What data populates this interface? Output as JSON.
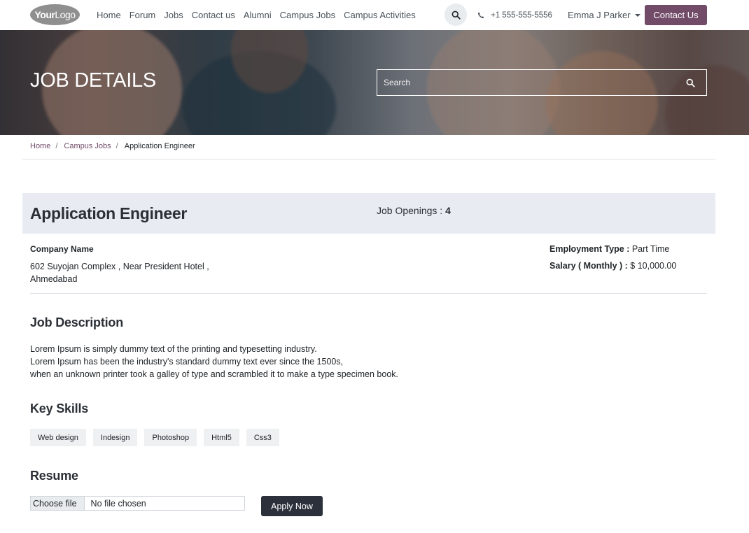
{
  "brand": {
    "logo_bold": "Your",
    "logo_light": "Logo"
  },
  "nav": {
    "links": [
      "Home",
      "Forum",
      "Jobs",
      "Contact us",
      "Alumni",
      "Campus Jobs",
      "Campus Activities"
    ],
    "phone": "+1 555-555-5556",
    "user_name": "Emma J Parker",
    "contact_button": "Contact Us"
  },
  "hero": {
    "title": "JOB DETAILS",
    "search_placeholder": "Search"
  },
  "breadcrumb": {
    "items": [
      "Home",
      "Campus Jobs"
    ],
    "current": "Application Engineer"
  },
  "job": {
    "title": "Application Engineer",
    "openings_label": "Job Openings : ",
    "openings_value": "4",
    "company_label": "Company Name",
    "address_line1": "602 Suyojan Complex , Near President Hotel ,",
    "address_line2": "Ahmedabad",
    "employment_type_label": "Employment Type : ",
    "employment_type_value": "Part Time",
    "salary_label": "Salary ( Monthly ) : ",
    "salary_value": "$ 10,000.00"
  },
  "description": {
    "title": "Job Description",
    "lines": [
      "Lorem Ipsum is simply dummy text of the printing and typesetting industry.",
      "Lorem Ipsum has been the industry's standard dummy text ever since the 1500s,",
      "when an unknown printer took a galley of type and scrambled it to make a type specimen book."
    ]
  },
  "skills": {
    "title": "Key Skills",
    "items": [
      "Web design",
      "Indesign",
      "Photoshop",
      "Html5",
      "Css3"
    ]
  },
  "resume": {
    "title": "Resume",
    "file_button": "Choose file",
    "file_status": "No file chosen",
    "apply_button": "Apply Now"
  },
  "colors": {
    "brand": "#714b67",
    "dark_button": "#2b303b",
    "header_band": "#e8ecf2"
  },
  "icons": {
    "search": "search-icon",
    "phone": "phone-icon",
    "caret": "caret-down-icon"
  }
}
